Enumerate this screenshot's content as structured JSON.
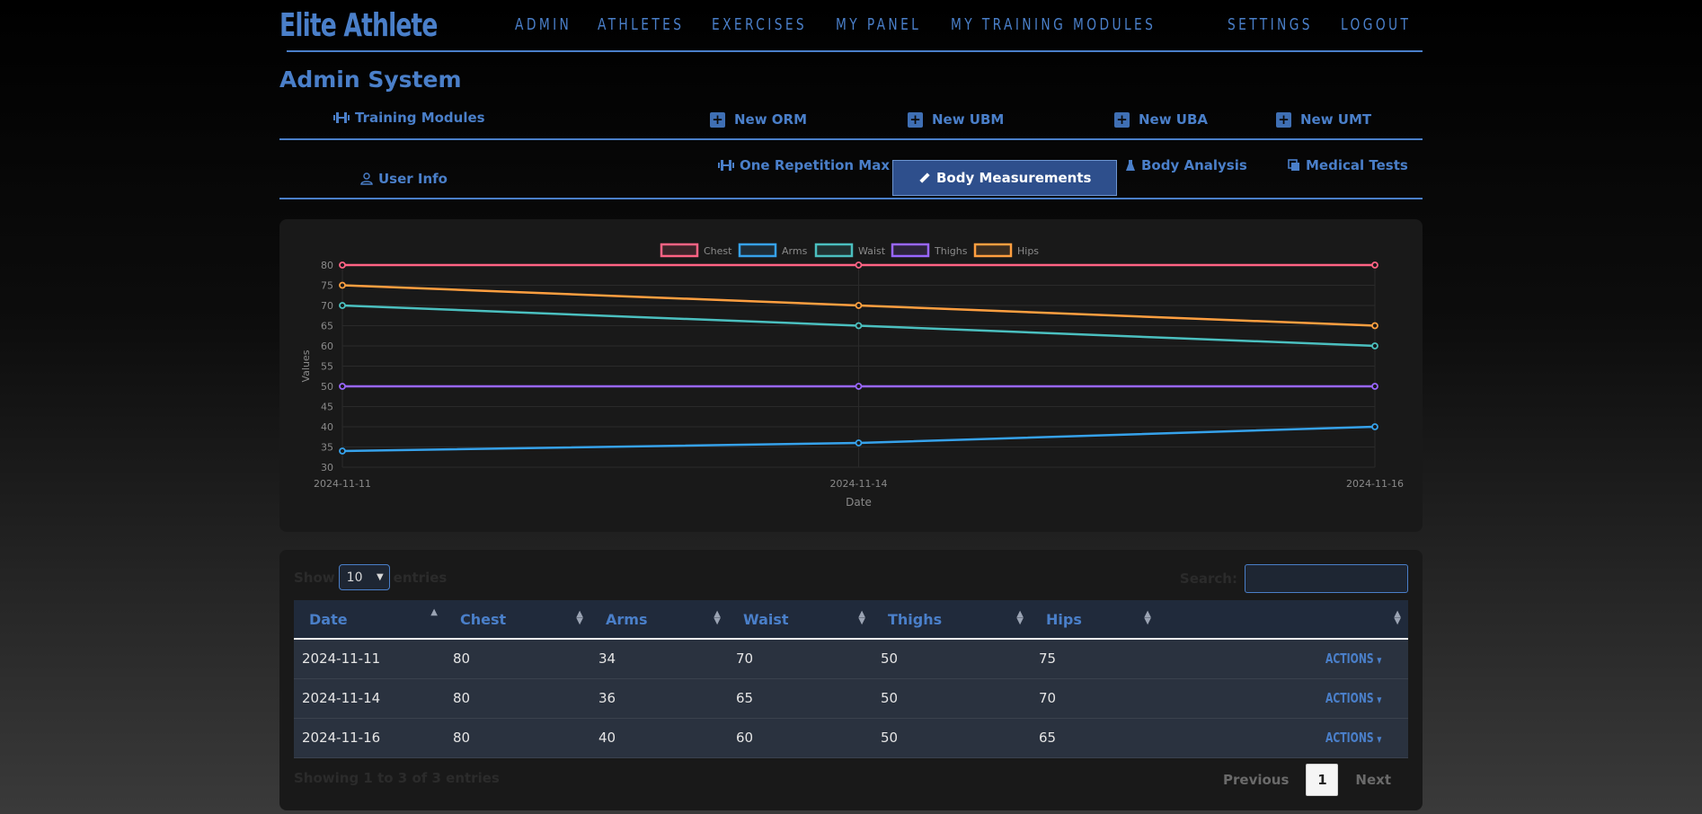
{
  "brand": "Elite Athlete",
  "nav": [
    "ADMIN",
    "ATHLETES",
    "EXERCISES",
    "MY PANEL",
    "MY TRAINING MODULES",
    "SETTINGS",
    "LOGOUT"
  ],
  "page_title": "Admin System",
  "row1": {
    "training_modules": "Training Modules",
    "new_orm": "New ORM",
    "new_ubm": "New UBM",
    "new_uba": "New UBA",
    "new_umt": "New UMT"
  },
  "row2": {
    "user_info": "User Info",
    "one_rep_max": "One Repetition Max",
    "body_measurements": "Body Measurements",
    "body_analysis": "Body Analysis",
    "medical_tests": "Medical Tests"
  },
  "colors": {
    "accent": "#4a7fc9",
    "Chest": "#ff6384",
    "Arms": "#36a2eb",
    "Waist": "#4bc0c0",
    "Thighs": "#9966ff",
    "Hips": "#ff9f40"
  },
  "chart_data": {
    "type": "line",
    "x": [
      "2024-11-11",
      "2024-11-14",
      "2024-11-16"
    ],
    "xlabel": "Date",
    "ylabel": "Values",
    "ylim": [
      30,
      80
    ],
    "yticks": [
      30,
      35,
      40,
      45,
      50,
      55,
      60,
      65,
      70,
      75,
      80
    ],
    "legend_position": "top",
    "series": [
      {
        "name": "Chest",
        "values": [
          80,
          80,
          80
        ]
      },
      {
        "name": "Arms",
        "values": [
          34,
          36,
          40
        ]
      },
      {
        "name": "Waist",
        "values": [
          70,
          65,
          60
        ]
      },
      {
        "name": "Thighs",
        "values": [
          50,
          50,
          50
        ]
      },
      {
        "name": "Hips",
        "values": [
          75,
          70,
          65
        ]
      }
    ]
  },
  "table": {
    "show_label": "Show",
    "entries_label": "entries",
    "page_size": "10",
    "search_label": "Search:",
    "columns": [
      "Date",
      "Chest",
      "Arms",
      "Waist",
      "Thighs",
      "Hips",
      ""
    ],
    "rows": [
      [
        "2024-11-11",
        "80",
        "34",
        "70",
        "50",
        "75"
      ],
      [
        "2024-11-14",
        "80",
        "36",
        "65",
        "50",
        "70"
      ],
      [
        "2024-11-16",
        "80",
        "40",
        "60",
        "50",
        "65"
      ]
    ],
    "actions_label": "ACTIONS",
    "info": "Showing 1 to 3 of 3 entries",
    "previous": "Previous",
    "current_page": "1",
    "next": "Next"
  }
}
